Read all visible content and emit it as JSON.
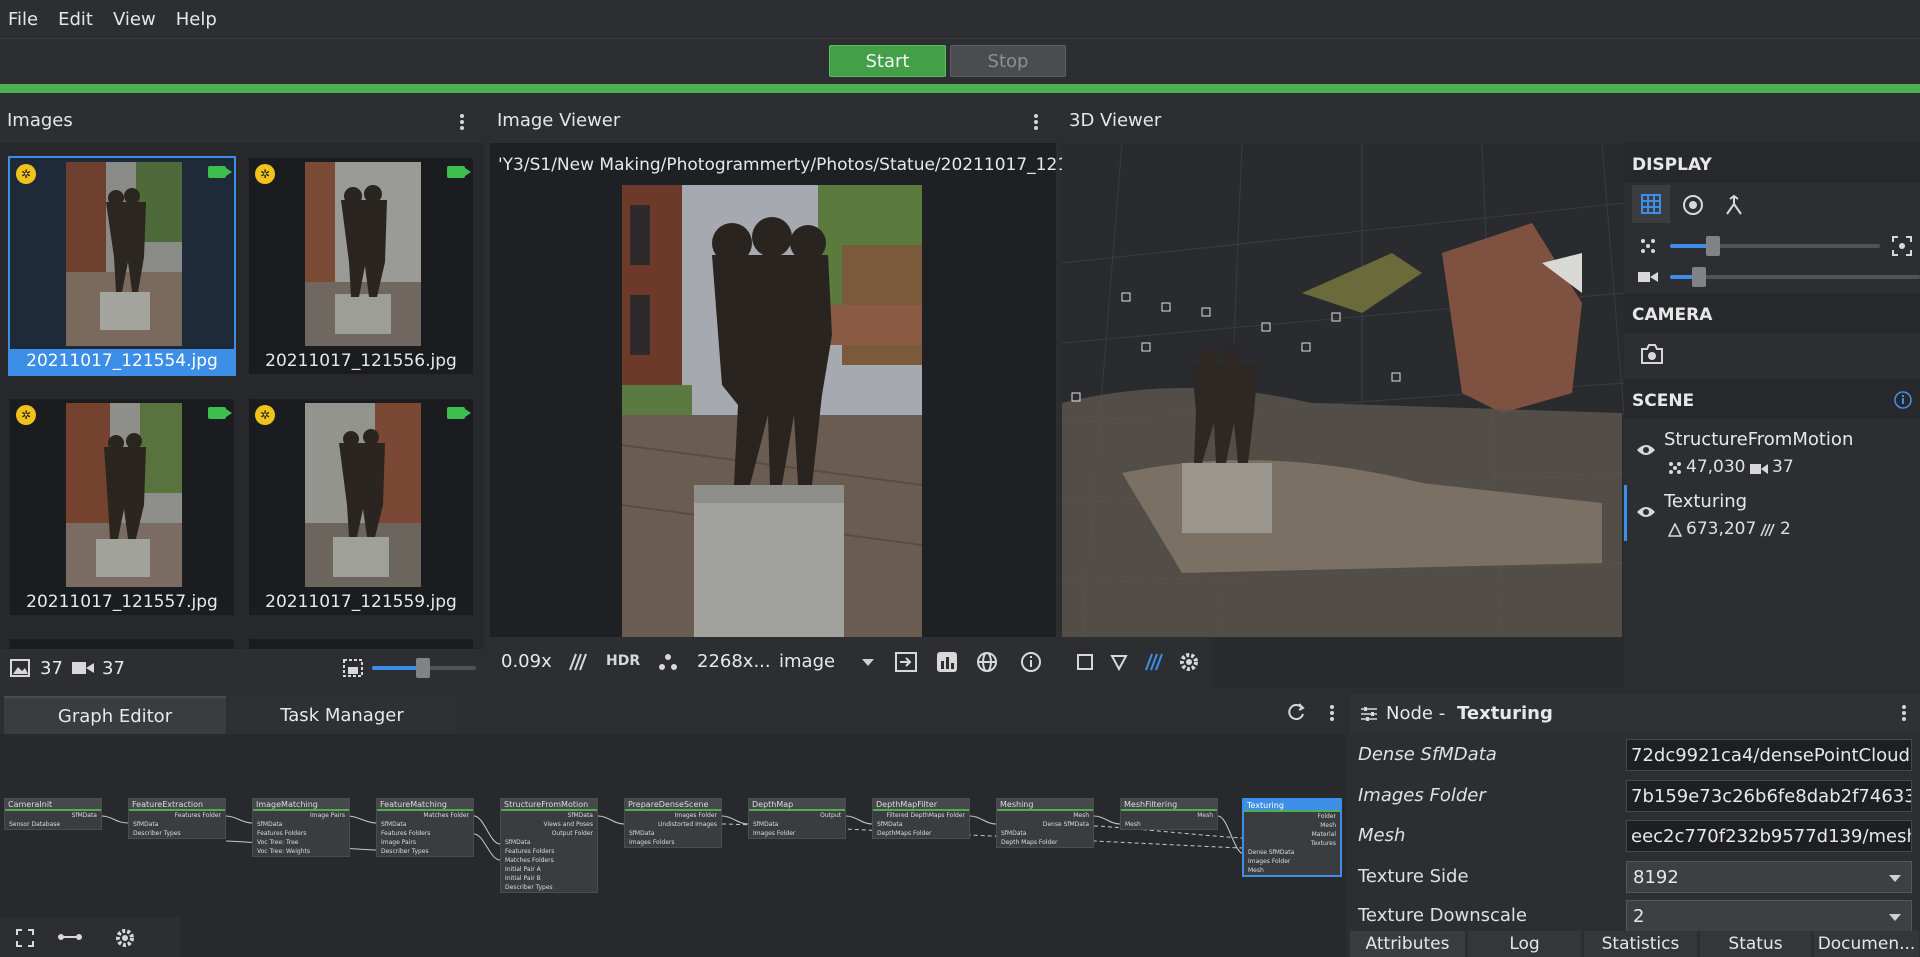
{
  "menu": [
    "File",
    "Edit",
    "View",
    "Help"
  ],
  "toolbar": {
    "start_label": "Start",
    "stop_label": "Stop"
  },
  "images": {
    "title": "Images",
    "items": [
      {
        "name": "20211017_121554.jpg",
        "selected": true
      },
      {
        "name": "20211017_121556.jpg",
        "selected": false
      },
      {
        "name": "20211017_121557.jpg",
        "selected": false
      },
      {
        "name": "20211017_121559.jpg",
        "selected": false
      }
    ],
    "image_count": "37",
    "camera_count": "37"
  },
  "viewer": {
    "title": "Image Viewer",
    "path": "'Y3/S1/New Making/Photogrammerty/Photos/Statue/20211017_121554.jpg",
    "zoom": "0.09x",
    "hdr_label": "HDR",
    "resolution": "2268x...",
    "mode": "image"
  },
  "viewer3d": {
    "title": "3D Viewer"
  },
  "sidebar": {
    "display_title": "DISPLAY",
    "camera_title": "CAMERA",
    "scene_title": "SCENE",
    "point_size_level": 0.2,
    "camera_scale_level": 0.12,
    "scene": [
      {
        "name": "StructureFromMotion",
        "meta1": "47,030",
        "meta2": "37"
      },
      {
        "name": "Texturing",
        "meta1": "673,207",
        "meta2": "2"
      }
    ]
  },
  "graph": {
    "tab_graph": "Graph Editor",
    "tab_task": "Task Manager",
    "nodes": [
      {
        "name": "CameraInit",
        "rows": [
          "SfMData",
          "Sensor Database"
        ]
      },
      {
        "name": "FeatureExtraction",
        "rows": [
          "Features Folder",
          "SfMData",
          "Describer Types"
        ]
      },
      {
        "name": "ImageMatching",
        "rows": [
          "Image Pairs",
          "SfMData",
          "Features Folders",
          "Voc Tree: Tree",
          "Voc Tree: Weights"
        ]
      },
      {
        "name": "FeatureMatching",
        "rows": [
          "Matches Folder",
          "SfMData",
          "Features Folders",
          "Image Pairs",
          "Describer Types"
        ]
      },
      {
        "name": "StructureFromMotion",
        "rows": [
          "SfMData",
          "Views and Poses",
          "Output Folder",
          "SfMData",
          "Features Folders",
          "Matches Folders",
          "Initial Pair A",
          "Initial Pair B",
          "Describer Types"
        ]
      },
      {
        "name": "PrepareDenseScene",
        "rows": [
          "Images Folder",
          "Undistorted Images",
          "SfMData",
          "Images Folders"
        ]
      },
      {
        "name": "DepthMap",
        "rows": [
          "Output",
          "SfMData",
          "Images Folder"
        ]
      },
      {
        "name": "DepthMapFilter",
        "rows": [
          "Filtered DepthMaps Folder",
          "SfMData",
          "DepthMaps Folder"
        ]
      },
      {
        "name": "Meshing",
        "rows": [
          "Mesh",
          "Dense SfMData",
          "SfMData",
          "Depth Maps Folder"
        ]
      },
      {
        "name": "MeshFiltering",
        "rows": [
          "Mesh",
          "Mesh"
        ]
      },
      {
        "name": "Texturing",
        "rows": [
          "Folder",
          "Mesh",
          "Material",
          "Textures",
          "Dense SfMData",
          "Images Folder",
          "Mesh"
        ]
      }
    ]
  },
  "node": {
    "prefix": "Node - ",
    "name": "Texturing",
    "attributes": [
      {
        "name": "Dense SfMData",
        "value": "72dc9921ca4/densePointCloud.abc"
      },
      {
        "name": "Images Folder",
        "value": "7b159e73c26b6fe8dab2f74633be6"
      },
      {
        "name": "Mesh",
        "value": "eec2c770f232b9577d139/mesh.obj"
      },
      {
        "name": "Texture Side",
        "value": "8192"
      },
      {
        "name": "Texture Downscale",
        "value": "2"
      }
    ],
    "tabs": [
      "Attributes",
      "Log",
      "Statistics",
      "Status",
      "Documen..."
    ]
  }
}
